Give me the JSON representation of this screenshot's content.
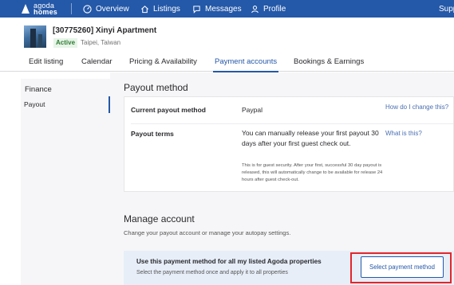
{
  "brand": {
    "line1": "agoda",
    "line2": "homes",
    "icon": "agoda-homes-logo"
  },
  "nav": {
    "items": [
      {
        "label": "Overview",
        "icon": "overview-icon"
      },
      {
        "label": "Listings",
        "icon": "home-icon"
      },
      {
        "label": "Messages",
        "icon": "chat-icon"
      },
      {
        "label": "Profile",
        "icon": "person-icon"
      }
    ],
    "support_label": "Supp"
  },
  "property": {
    "title": "[30775260] Xinyi Apartment",
    "status": "Active",
    "location": "Taipei, Taiwan"
  },
  "tabs": [
    {
      "label": "Edit listing"
    },
    {
      "label": "Calendar"
    },
    {
      "label": "Pricing & Availability"
    },
    {
      "label": "Payment accounts",
      "active": true
    },
    {
      "label": "Bookings & Earnings"
    }
  ],
  "sidebar": {
    "heading": "Finance",
    "items": [
      {
        "label": "Payout",
        "active": true
      }
    ]
  },
  "payout": {
    "title": "Payout method",
    "current_label": "Current payout method",
    "current_value": "Paypal",
    "current_help": "How do I change this?",
    "terms_label": "Payout terms",
    "terms_text": "You can manually release your first payout 30 days after your first guest check out.",
    "terms_help": "What is this?",
    "terms_note": "This is for guest security. After your first, successful 30 day payout is released, this will automatically change to be available for release 24 hours after guest check-out."
  },
  "manage": {
    "title": "Manage account",
    "subtitle": "Change your payout account or manage your autopay settings.",
    "card_title": "Use this payment method for all my listed Agoda properties",
    "card_subtitle": "Select the payment method once and apply it to all properties",
    "button_label": "Select payment method"
  },
  "colors": {
    "brand_blue": "#2458a8",
    "highlight_red": "#e3262b",
    "active_green": "#2e7d32"
  }
}
